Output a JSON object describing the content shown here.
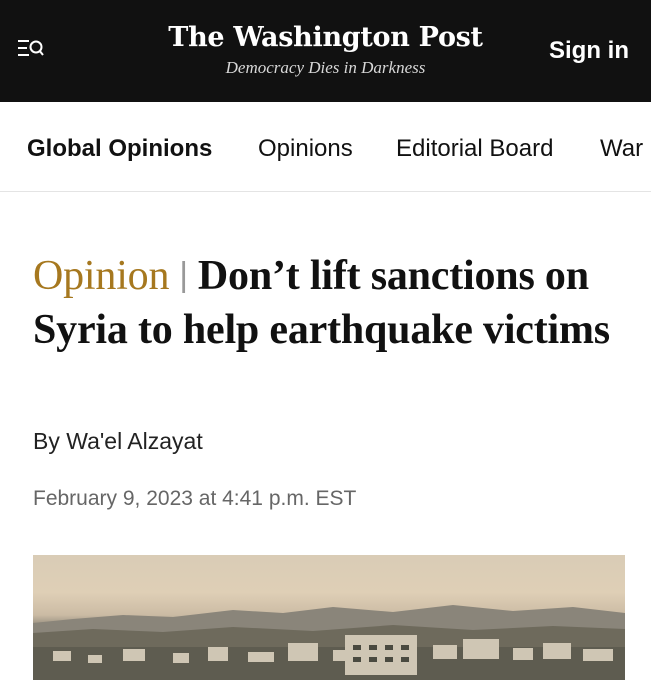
{
  "header": {
    "logo": "The Washington Post",
    "tagline": "Democracy Dies in Darkness",
    "sign_in": "Sign in",
    "menu_icon": "menu-search-icon"
  },
  "subnav": {
    "items": [
      "Global Opinions",
      "Opinions",
      "Editorial Board",
      "War"
    ]
  },
  "article": {
    "kicker": "Opinion",
    "separator": "|",
    "title": "Don’t lift sanctions on Syria to help earthquake victims",
    "byline_prefix": "By ",
    "author": "Wa'el Alzayat",
    "date": "February 9, 2023 at 4:41 p.m. EST"
  },
  "colors": {
    "header_bg": "#111111",
    "kicker": "#a6781f",
    "date": "#666666"
  }
}
